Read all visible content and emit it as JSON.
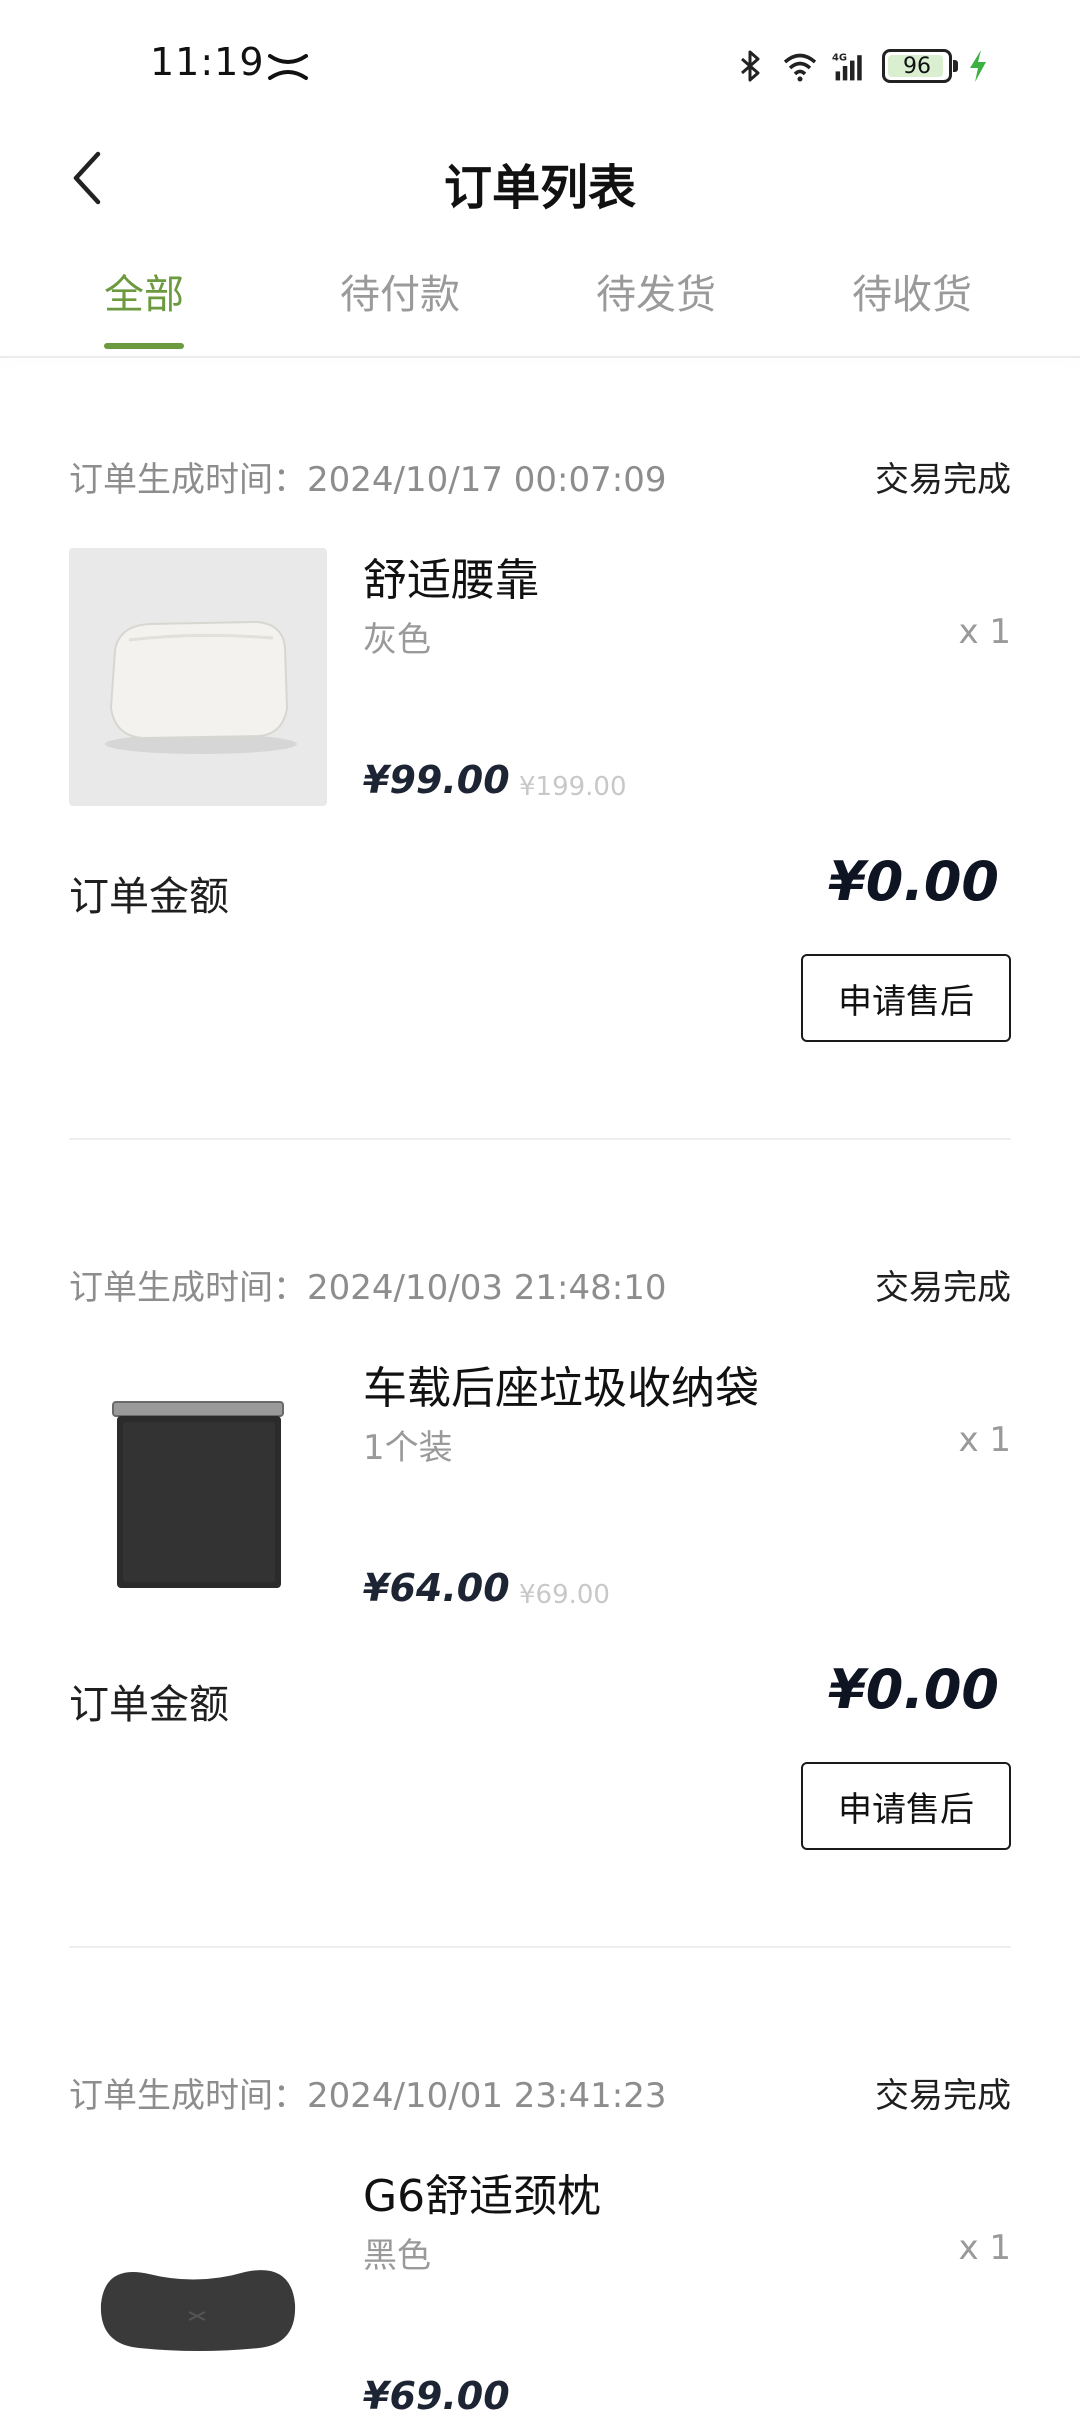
{
  "status_bar": {
    "time": "11:19",
    "battery": "96",
    "battery_level": 0.96,
    "network": "4G"
  },
  "header": {
    "title": "订单列表"
  },
  "tabs": [
    {
      "label": "全部",
      "active": true
    },
    {
      "label": "待付款",
      "active": false
    },
    {
      "label": "待发货",
      "active": false
    },
    {
      "label": "待收货",
      "active": false
    }
  ],
  "colors": {
    "accent": "#6c9a3e",
    "price": "#1d2433"
  },
  "orders": [
    {
      "time": "订单生成时间：2024/10/17 00:07:09",
      "status": "交易完成",
      "product_name": "舒适腰靠",
      "spec": "灰色",
      "qty": "x 1",
      "price": "¥99.00",
      "original_price": "¥199.00",
      "amount_label": "订单金额",
      "amount": "¥0.00",
      "action": "申请售后"
    },
    {
      "time": "订单生成时间：2024/10/03 21:48:10",
      "status": "交易完成",
      "product_name": "车载后座垃圾收纳袋",
      "spec": "1个装",
      "qty": "x 1",
      "price": "¥64.00",
      "original_price": "¥69.00",
      "amount_label": "订单金额",
      "amount": "¥0.00",
      "action": "申请售后"
    },
    {
      "time": "订单生成时间：2024/10/01 23:41:23",
      "status": "交易完成",
      "product_name": "G6舒适颈枕",
      "spec": "黑色",
      "qty": "x 1",
      "price": "¥69.00"
    }
  ]
}
